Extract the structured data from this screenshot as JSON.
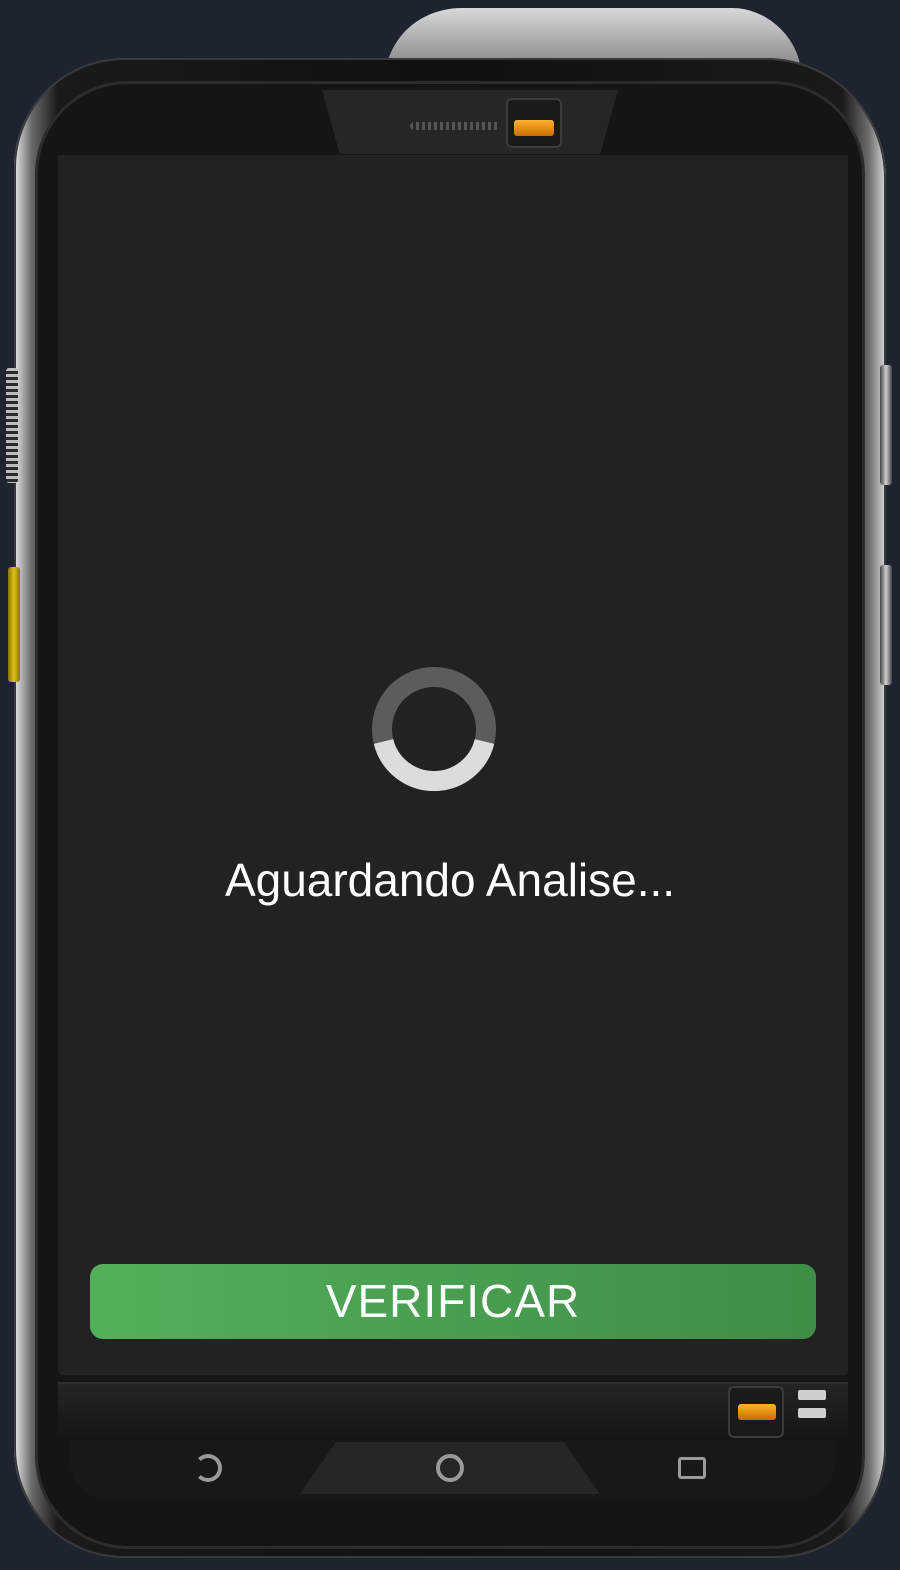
{
  "screen": {
    "status_text": "Aguardando Analise...",
    "spinner_icon": "loading-spinner-icon"
  },
  "actions": {
    "verify_label": "VERIFICAR"
  },
  "navigation": {
    "back_icon": "back-icon",
    "home_icon": "home-icon",
    "recent_icon": "recent-apps-icon"
  },
  "colors": {
    "background": "#1e2330",
    "screen": "#222222",
    "button_green": "#4caf50",
    "spinner_track": "#666666",
    "spinner_arc": "#dddddd",
    "sensor_orange": "#ffa726"
  }
}
